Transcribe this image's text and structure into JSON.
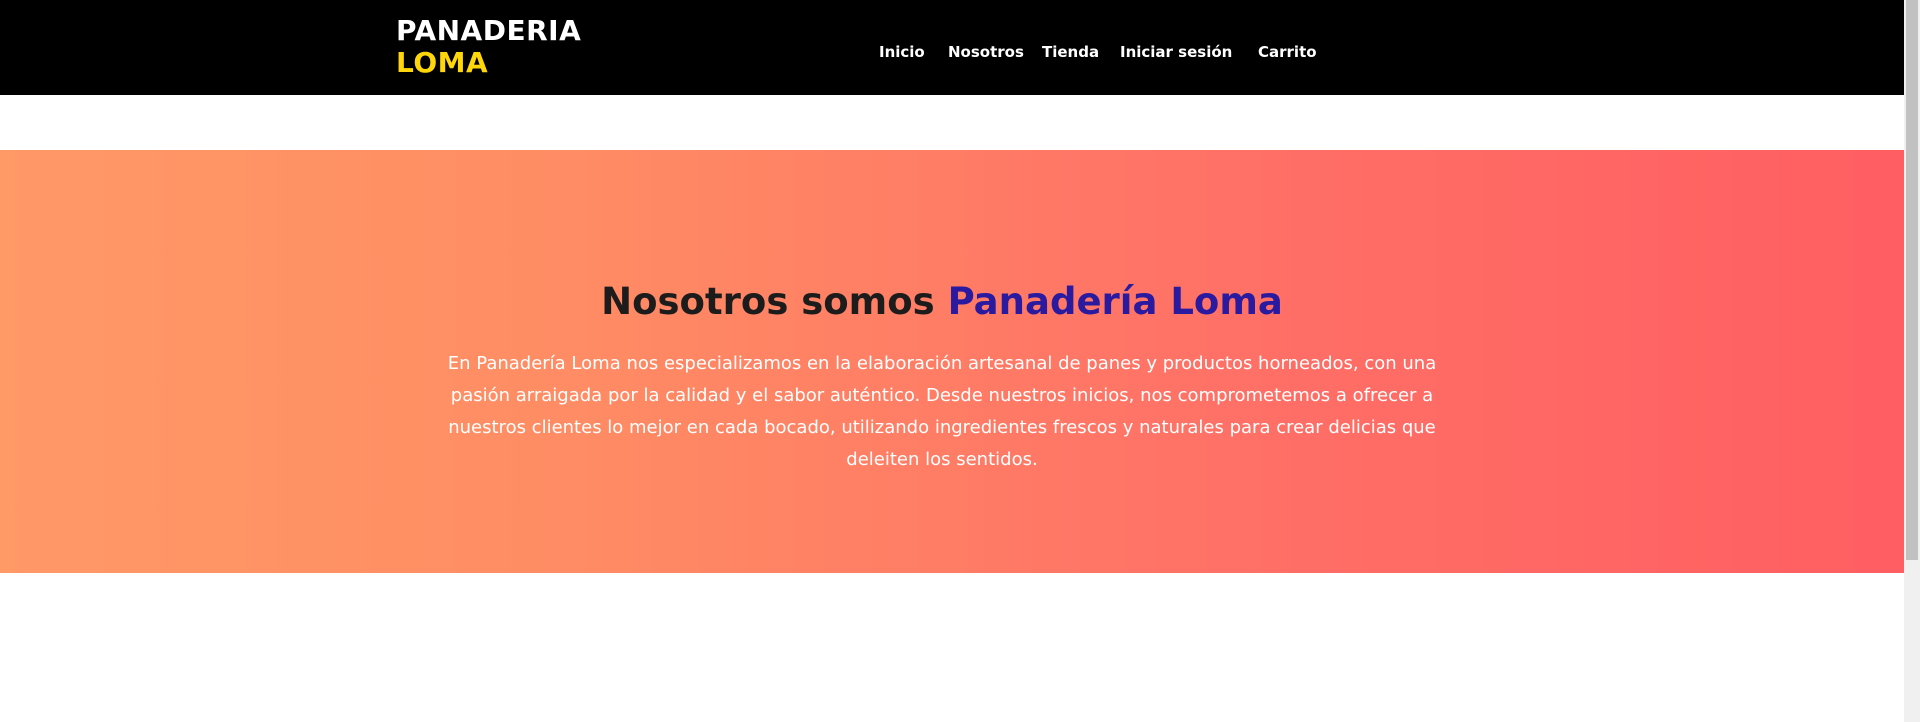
{
  "navbar": {
    "brand_line1": "PANADERIA",
    "brand_line2": "LOMA",
    "brand_colors": {
      "primary": "#ffffff",
      "accent": "#ffd60a"
    },
    "links": [
      {
        "label": "Inicio"
      },
      {
        "label": "Nosotros"
      },
      {
        "label": "Tienda"
      },
      {
        "label": "Iniciar sesión"
      },
      {
        "label": "Carrito"
      }
    ]
  },
  "hero": {
    "title_prefix": "Nosotros somos",
    "title_accent": "Panadería Loma",
    "description": "En Panadería Loma nos especializamos en la elaboración artesanal de panes y productos horneados, con una pasión arraigada por la calidad y el sabor auténtico. Desde nuestros inicios, nos comprometemos a ofrecer a nuestros clientes lo mejor en cada bocado, utilizando ingredientes frescos y naturales para crear delicias que deleiten los sentidos.",
    "gradient": {
      "from": "#ff9966",
      "to": "#ff5e62"
    },
    "title_accent_color": "#2a1aa0"
  }
}
